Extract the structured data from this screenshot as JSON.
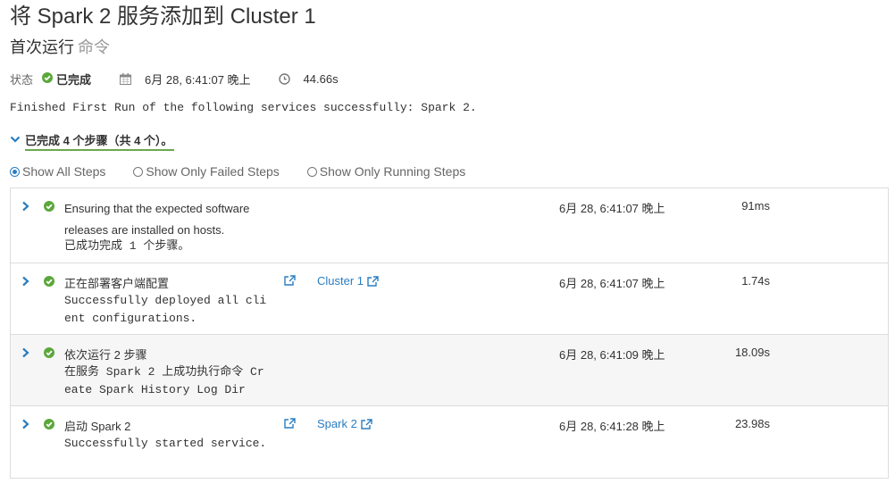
{
  "header": {
    "title": "将 Spark 2 服务添加到 Cluster 1",
    "subtitle": "首次运行",
    "subtitle_muted": "命令"
  },
  "meta": {
    "status_label": "状态",
    "status_value": "已完成",
    "start_time": "6月 28, 6:41:07 晚上",
    "duration": "44.66s"
  },
  "summary": "Finished First Run of the following services successfully: Spark 2.",
  "steps_toggle": "已完成 4 个步骤（共 4 个）。",
  "filters": {
    "all": "Show All Steps",
    "failed": "Show Only Failed Steps",
    "running": "Show Only Running Steps",
    "selected": "all"
  },
  "steps": [
    {
      "name": "Ensuring that the expected software releases are installed on hosts.",
      "desc": "已成功完成 1 个步骤。",
      "link": "",
      "time": "6月 28, 6:41:07 晚上",
      "duration": "91ms"
    },
    {
      "name": "正在部署客户端配置",
      "desc": "Successfully deployed all client configurations.",
      "link": "Cluster 1",
      "time": "6月 28, 6:41:07 晚上",
      "duration": "1.74s"
    },
    {
      "name": "依次运行 2 步骤",
      "desc": "在服务 Spark 2 上成功执行命令 Create Spark History Log Dir",
      "link": "",
      "time": "6月 28, 6:41:09 晚上",
      "duration": "18.09s"
    },
    {
      "name": "启动 Spark 2",
      "desc": "Successfully started service.",
      "link": "Spark 2",
      "time": "6月 28, 6:41:28 晚上",
      "duration": "23.98s"
    }
  ],
  "colors": {
    "success": "#5ca73c",
    "link": "#2a7dc1",
    "accent_underline": "#6aa84f"
  }
}
